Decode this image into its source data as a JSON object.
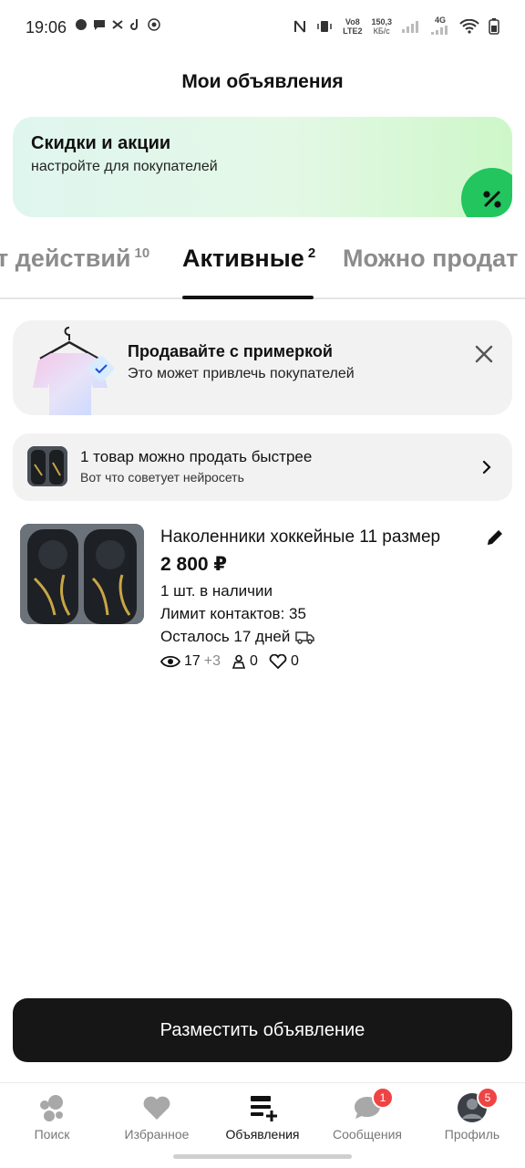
{
  "status_bar": {
    "time": "19:06",
    "speed": "150,3",
    "speed_unit": "КБ/с",
    "network": "4G",
    "volte_top": "Vo8",
    "volte_bottom": "LTE2"
  },
  "header": {
    "title": "Мои объявления"
  },
  "promo": {
    "title": "Скидки и акции",
    "subtitle": "настройте для покупателей",
    "badge_icon": "percent-icon"
  },
  "tabs": [
    {
      "label": "т действий",
      "count": "10"
    },
    {
      "label": "Активные",
      "count": "2"
    },
    {
      "label": "Можно продат",
      "count": ""
    }
  ],
  "fitting_card": {
    "title": "Продавайте с примеркой",
    "subtitle": "Это может привлечь покупателей"
  },
  "faster_card": {
    "title": "1 товар можно продать быстрее",
    "subtitle": "Вот что советует нейросеть"
  },
  "listing": {
    "title": "Наколенники хоккейные 11 размер",
    "price": "2 800 ₽",
    "stock": "1 шт. в наличии",
    "contact_limit": "Лимит контактов: 35",
    "days_left": "Осталось 17 дней",
    "views": "17",
    "views_plus": "+3",
    "contacts": "0",
    "favorites": "0"
  },
  "post_button": {
    "label": "Разместить объявление"
  },
  "bottom_nav": [
    {
      "label": "Поиск",
      "icon": "search-dots-icon"
    },
    {
      "label": "Избранное",
      "icon": "heart-icon"
    },
    {
      "label": "Объявления",
      "icon": "listings-add-icon",
      "active": true
    },
    {
      "label": "Сообщения",
      "icon": "chat-icon",
      "badge": "1"
    },
    {
      "label": "Профиль",
      "icon": "avatar-icon",
      "badge": "5"
    }
  ],
  "colors": {
    "accent_green": "#22c55e",
    "badge_red": "#ef4444",
    "button_dark": "#161616"
  }
}
